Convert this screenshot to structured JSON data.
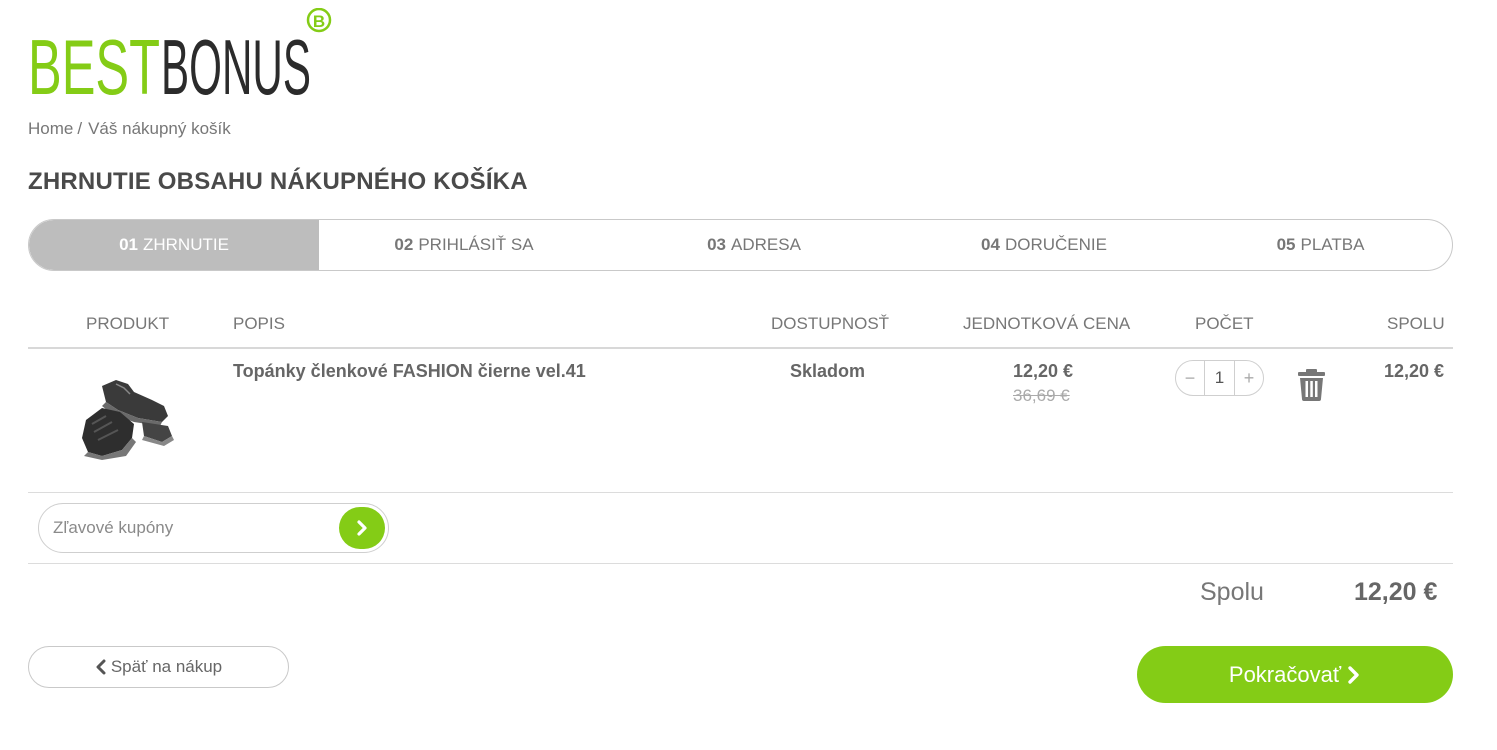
{
  "brand": {
    "part1": "BEST",
    "part2": "BONUS",
    "badge": "B",
    "accent": "#84cc16",
    "dark": "#2b2b2b"
  },
  "breadcrumb": {
    "home": "Home",
    "separator": "/",
    "current": "Váš nákupný košík"
  },
  "page_title": "ZHRNUTIE OBSAHU NÁKUPNÉHO KOŠÍKA",
  "steps": [
    {
      "num": "01",
      "label": "ZHRNUTIE",
      "active": true
    },
    {
      "num": "02",
      "label": "PRIHLÁSIŤ SA"
    },
    {
      "num": "03",
      "label": "ADRESA"
    },
    {
      "num": "04",
      "label": "DORUČENIE"
    },
    {
      "num": "05",
      "label": "PLATBA"
    }
  ],
  "table": {
    "headers": {
      "product": "PRODUKT",
      "description": "POPIS",
      "availability": "DOSTUPNOSŤ",
      "unit_price": "JEDNOTKOVÁ CENA",
      "quantity": "POČET",
      "total": "SPOLU"
    },
    "items": [
      {
        "name": "Topánky členkové FASHION čierne vel.41",
        "availability": "Skladom",
        "price": "12,20 €",
        "old_price": "36,69 €",
        "quantity": "1",
        "total": "12,20 €",
        "minus": "−",
        "plus": "+"
      }
    ]
  },
  "coupon": {
    "placeholder": "Zľavové kupóny"
  },
  "summary": {
    "label": "Spolu",
    "value": "12,20 €"
  },
  "buttons": {
    "back": "Späť na nákup",
    "continue": "Pokračovať"
  }
}
